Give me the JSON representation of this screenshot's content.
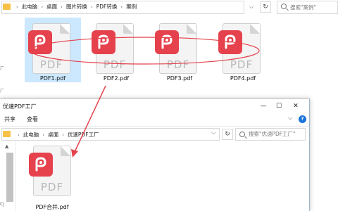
{
  "background_window": {
    "breadcrumb": [
      "此电脑",
      "桌面",
      "图片转换",
      "PDF转换",
      "案例"
    ],
    "search_placeholder": "搜索\"案例\"",
    "edge_fragments": [
      "厂",
      "厂"
    ],
    "files": [
      {
        "name": "PDF1.pdf",
        "selected": true
      },
      {
        "name": "PDF2.pdf",
        "selected": false
      },
      {
        "name": "PDF3.pdf",
        "selected": false
      },
      {
        "name": "PDF4.pdf",
        "selected": false
      }
    ]
  },
  "foreground_window": {
    "title": "优速PDF工厂",
    "ribbon_tabs": [
      "共享",
      "查看"
    ],
    "breadcrumb": [
      "此电脑",
      "桌面",
      "优速PDF工厂"
    ],
    "search_placeholder": "搜索\"优速PDF工厂\"",
    "nav_fragment": "Cj",
    "files": [
      {
        "name": "PDF合并.pdf"
      }
    ]
  },
  "icon_text": "PDF",
  "colors": {
    "pdf_badge": "#e5424d",
    "annotation": "#e5424d",
    "selection": "#cce8ff",
    "folder": "#f6c146"
  },
  "icons": [
    "folder-icon",
    "chevron-down-icon",
    "refresh-icon",
    "search-icon",
    "pdf-file-icon",
    "minimize-icon",
    "maximize-icon",
    "close-icon",
    "help-icon"
  ]
}
